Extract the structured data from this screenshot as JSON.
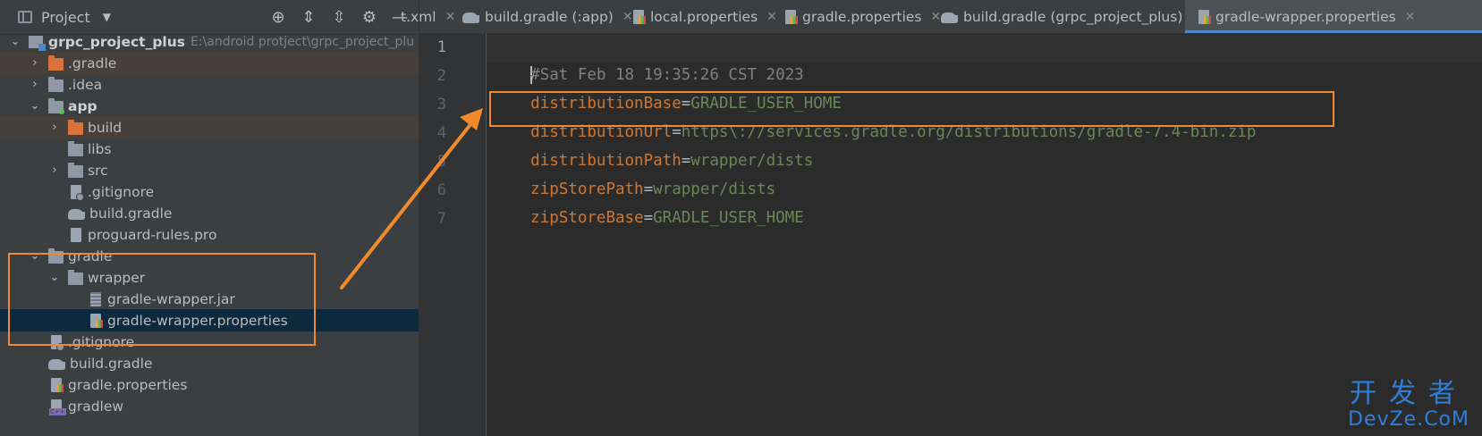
{
  "project_panel": {
    "title": "Project",
    "tree": [
      {
        "label": "grpc_project_plus",
        "path": "E:\\android protject\\grpc_project_plu",
        "kind": "project",
        "expanded": true,
        "depth": 0
      },
      {
        "label": ".gradle",
        "kind": "folder-orange",
        "expanded": false,
        "depth": 1,
        "highlight": true
      },
      {
        "label": ".idea",
        "kind": "folder",
        "expanded": false,
        "depth": 1
      },
      {
        "label": "app",
        "kind": "module",
        "expanded": true,
        "depth": 1
      },
      {
        "label": "build",
        "kind": "folder-orange",
        "expanded": false,
        "depth": 2,
        "highlight": true
      },
      {
        "label": "libs",
        "kind": "folder",
        "depth": 2
      },
      {
        "label": "src",
        "kind": "folder",
        "expanded": false,
        "depth": 2
      },
      {
        "label": ".gitignore",
        "kind": "file-ignore",
        "depth": 2
      },
      {
        "label": "build.gradle",
        "kind": "gradle",
        "depth": 2
      },
      {
        "label": "proguard-rules.pro",
        "kind": "file",
        "depth": 2
      },
      {
        "label": "gradle",
        "kind": "folder",
        "expanded": true,
        "depth": 1
      },
      {
        "label": "wrapper",
        "kind": "folder",
        "expanded": true,
        "depth": 2
      },
      {
        "label": "gradle-wrapper.jar",
        "kind": "file-jar",
        "depth": 3
      },
      {
        "label": "gradle-wrapper.properties",
        "kind": "file-props",
        "depth": 3,
        "selected": true
      },
      {
        "label": ".gitignore",
        "kind": "file-ignore",
        "depth": 1
      },
      {
        "label": "build.gradle",
        "kind": "gradle",
        "depth": 1
      },
      {
        "label": "gradle.properties",
        "kind": "file-props",
        "depth": 1
      },
      {
        "label": "gradlew",
        "kind": "file-gradlew",
        "depth": 1
      }
    ]
  },
  "tabs": [
    {
      "label": "t.xml",
      "icon": "xml-file-icon"
    },
    {
      "label": "build.gradle (:app)",
      "icon": "gradle-elephant-icon"
    },
    {
      "label": "local.properties",
      "icon": "properties-file-icon"
    },
    {
      "label": "gradle.properties",
      "icon": "properties-file-icon"
    },
    {
      "label": "build.gradle (grpc_project_plus)",
      "icon": "gradle-elephant-icon"
    },
    {
      "label": "gradle-wrapper.properties",
      "icon": "properties-file-icon",
      "active": true
    }
  ],
  "editor": {
    "lines": [
      {
        "n": "1",
        "comment": "#Sat Feb 18 19:35:26 CST 2023"
      },
      {
        "n": "2",
        "key": "distributionBase",
        "value": "GRADLE_USER_HOME"
      },
      {
        "n": "3",
        "key": "distributionUrl",
        "value": "https\\://services.gradle.org/distributions/gradle-7.4-bin.zip"
      },
      {
        "n": "4",
        "key": "distributionPath",
        "value": "wrapper/dists"
      },
      {
        "n": "5",
        "key": "zipStorePath",
        "value": "wrapper/dists"
      },
      {
        "n": "6",
        "key": "zipStoreBase",
        "value": "GRADLE_USER_HOME"
      },
      {
        "n": "7"
      }
    ]
  },
  "watermark": {
    "cn": "开发者",
    "en": "DevZe.CoM"
  },
  "colors": {
    "accent": "#4a88c7",
    "annotation": "#f08a2c",
    "key": "#cc7832",
    "value": "#6a8759",
    "comment": "#808080"
  }
}
